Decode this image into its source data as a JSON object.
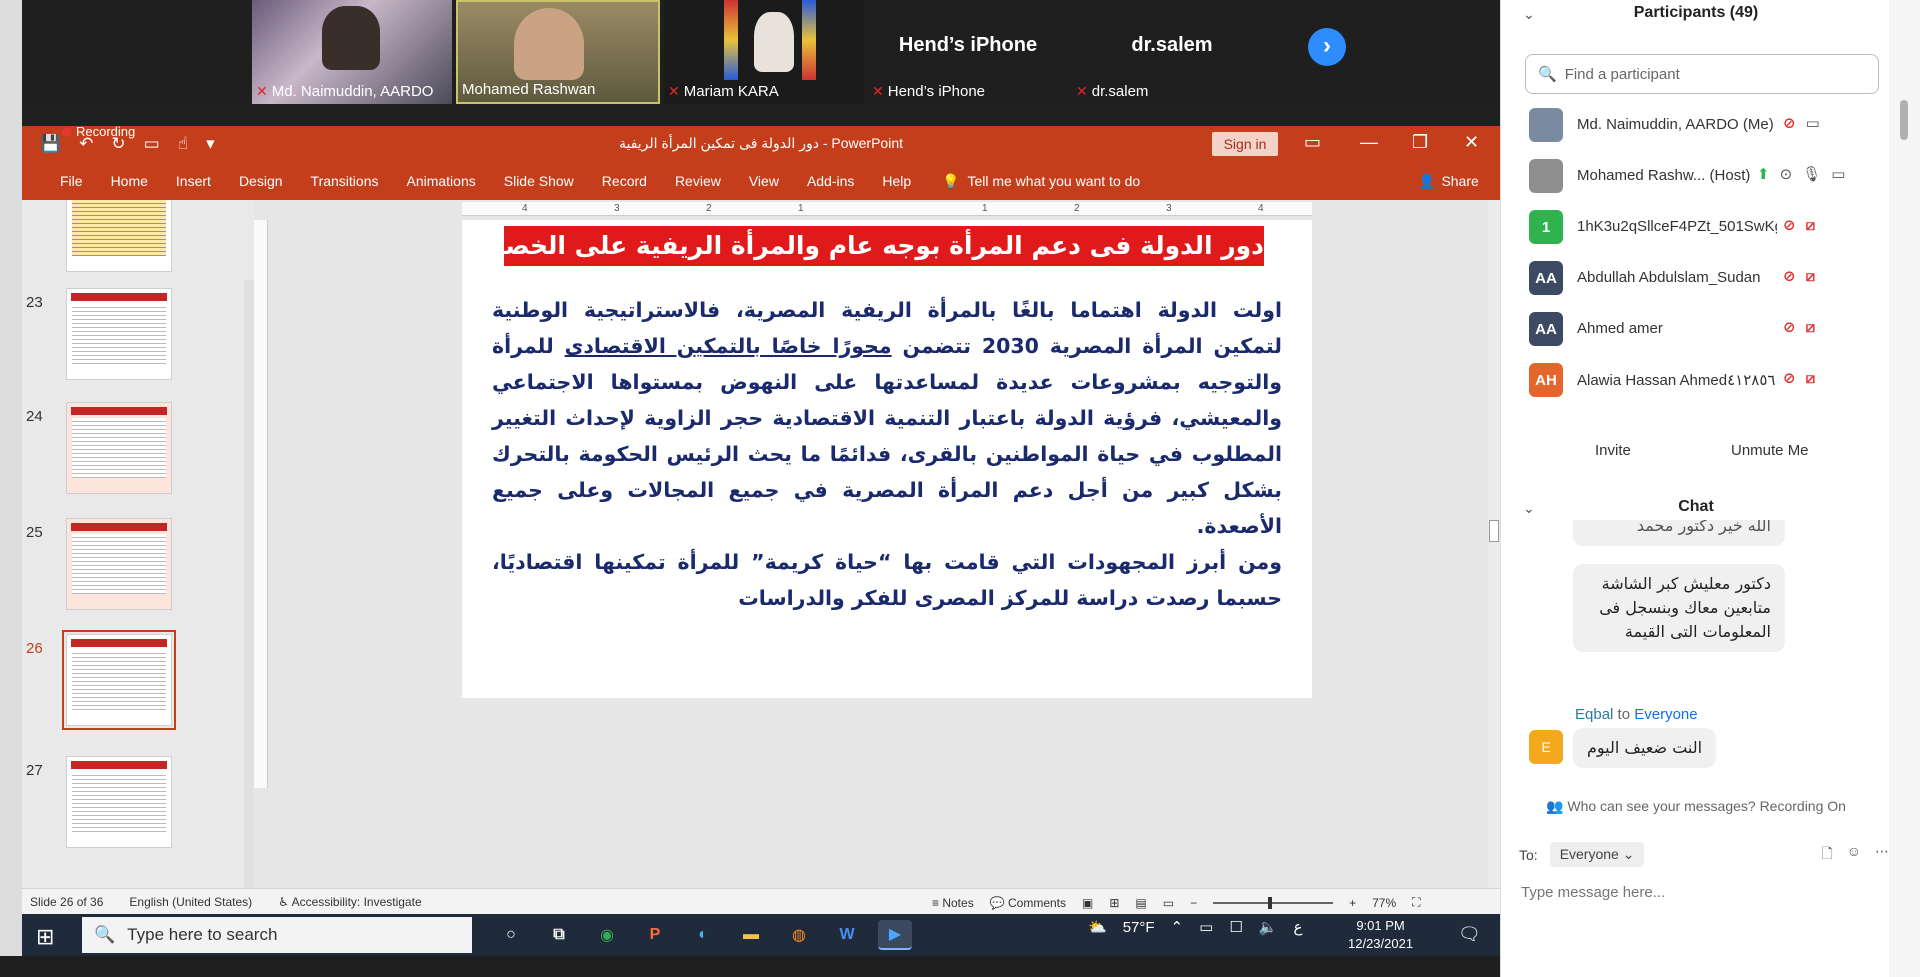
{
  "video_strip": {
    "tiles": [
      {
        "name": "Md. Naimuddin, AARDO",
        "muted": true
      },
      {
        "name": "Mohamed Rashwan",
        "muted": false
      },
      {
        "name": "Mariam KARA",
        "muted": true
      },
      {
        "name": "Hend’s iPhone",
        "muted": true,
        "big_name": "Hend’s iPhone"
      },
      {
        "name": "dr.salem",
        "muted": true,
        "big_name": "dr.salem"
      }
    ]
  },
  "recording": {
    "label": "Recording"
  },
  "ppt": {
    "doc_title": "دور الدولة فى تمكين المرأة الريفية  -  PowerPoint",
    "sign_in": "Sign in",
    "tabs": [
      "File",
      "Home",
      "Insert",
      "Design",
      "Transitions",
      "Animations",
      "Slide Show",
      "Record",
      "Review",
      "View",
      "Add-ins",
      "Help"
    ],
    "tell_me": "Tell me what you want to do",
    "share": "Share",
    "ruler_numbers": [
      "4",
      "3",
      "2",
      "1",
      "",
      "1",
      "2",
      "3",
      "4"
    ],
    "thumbnails": [
      {
        "num": "",
        "style": "yellow"
      },
      {
        "num": "23",
        "style": "plain"
      },
      {
        "num": "24",
        "style": "pink"
      },
      {
        "num": "25",
        "style": "pink"
      },
      {
        "num": "26",
        "style": "active"
      },
      {
        "num": "27",
        "style": "plain"
      }
    ],
    "slide": {
      "title": "دور الدولة فى دعم المرأة بوجه عام والمرأة الريفية على الخصوص",
      "para1_a": "اولت الدولة اهتماما بالغًا بالمرأة الريفية المصرية، فالاستراتيجية الوطنية لتمكين المرأة المصرية 2030 تتضمن",
      "para1_underlined": "محورًا خاصًا بالتمكين الاقتصادى",
      "para1_b": "للمرأة والتوجيه بمشروعات عديدة لمساعدتها على النهوض بمستواها الاجتماعي والمعيشي، فرؤية الدولة باعتبار التنمية الاقتصادية حجر الزاوية لإحداث التغيير المطلوب في حياة المواطنين بالقرى، فدائمًا ما يحث الرئيس الحكومة بالتحرك بشكل كبير من أجل دعم المرأة المصرية في جميع المجالات وعلى جميع الأصعدة.",
      "para2": "ومن أبرز المجهودات التي قامت بها “حياة كريمة” للمرأة تمكينها اقتصاديًا، حسبما رصدت دراسة للمركز المصرى للفكر والدراسات"
    },
    "status": {
      "slide_count": "Slide 26 of 36",
      "language": "English (United States)",
      "accessibility": "Accessibility: Investigate",
      "notes": "Notes",
      "comments": "Comments",
      "zoom": "77%",
      "zoom_fraction": 0.47
    }
  },
  "taskbar": {
    "search_placeholder": "Type here to search",
    "weather": "57°F",
    "lang": "ع",
    "time": "9:01 PM",
    "date": "12/23/2021"
  },
  "participants": {
    "header": "Participants (49)",
    "search_placeholder": "Find a participant",
    "list": [
      {
        "initials": "",
        "name": "Md. Naimuddin, AARDO (Me)",
        "color": "#7a8aa0",
        "photo": true
      },
      {
        "initials": "",
        "name": "Mohamed Rashw... (Host)",
        "color": "#8e8e8e",
        "photo": true,
        "host": true
      },
      {
        "initials": "1",
        "name": "1hK3u2qSllceF4PZt_501SwKgrA...",
        "color": "#2eb34e"
      },
      {
        "initials": "AA",
        "name": "Abdullah Abdulslam_Sudan",
        "color": "#3c4a63"
      },
      {
        "initials": "AA",
        "name": "Ahmed amer",
        "color": "#3c4a63"
      },
      {
        "initials": "AH",
        "name": "Alawia Hassan Ahmed٤١٢٨٥٦",
        "color": "#e5662c"
      }
    ],
    "invite": "Invite",
    "unmute": "Unmute Me"
  },
  "chat": {
    "header": "Chat",
    "partial_msg": "الله خير دكتور محمد",
    "msg1": "دكتور معليش كبر الشاشة متابعين معاك وبنسجل فى المعلومات التى القيمة",
    "sender_name": "Eqbal",
    "sender_to": "to",
    "sender_target": "Everyone",
    "sender_initial": "E",
    "msg2": "النت ضعيف اليوم",
    "who_can_see": "Who can see your messages? Recording On",
    "to_label": "To:",
    "to_value": "Everyone",
    "type_placeholder": "Type message here..."
  }
}
